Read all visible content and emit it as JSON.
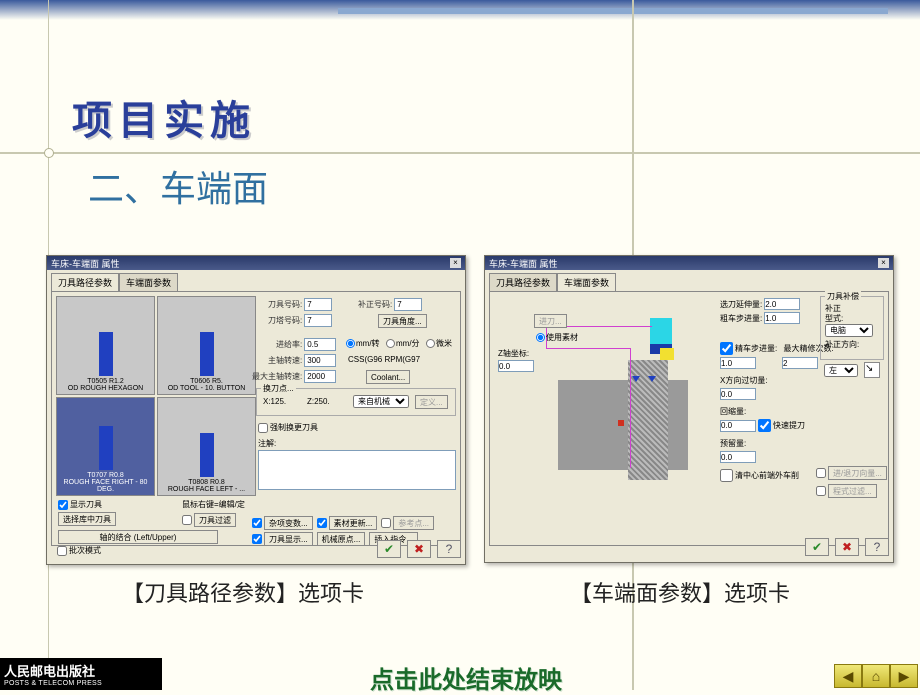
{
  "slide": {
    "title_main": "项目实施",
    "title_sub": "二、车端面",
    "caption_left": "【刀具路径参数】选项卡",
    "caption_right": "【车端面参数】选项卡",
    "footer_link": "点击此处结束放映"
  },
  "publisher": {
    "cn": "人民邮电出版社",
    "en": "POSTS & TELECOM PRESS"
  },
  "dialog_left": {
    "title": "车床-车端面 属性",
    "tabs": [
      "刀具路径参数",
      "车端面参数"
    ],
    "tools": [
      {
        "code": "T0505 R1.2",
        "desc": "OD ROUGH HEXAGON"
      },
      {
        "code": "T0606 R5.",
        "desc": "OD TOOL - 10. BUTTON"
      },
      {
        "code": "T0707 R0.8",
        "desc": "ROUGH FACE RIGHT - 80 DEG.",
        "selected": true
      },
      {
        "code": "T0808 R0.8",
        "desc": "ROUGH FACE LEFT - ..."
      }
    ],
    "show_tool_chk": "显示刀具",
    "select_lib_btn": "选择库中刀具",
    "mouse_hint": "鼠标右键=编辑/定",
    "tool_filter_btn": "刀具过滤",
    "axis_combine_btn": "轴的结合 (Left/Upper)",
    "batch_mode_chk": "批次模式",
    "fields": {
      "tool_num": {
        "label": "刀具号码:",
        "value": "7"
      },
      "offset_num": {
        "label": "补正号码:",
        "value": "7"
      },
      "station_num": {
        "label": "刀塔号码:",
        "value": "7"
      },
      "tool_angle_btn": "刀具角度...",
      "feed_rate": {
        "label": "进给率:",
        "value": "0.5"
      },
      "feed_unit_rev": "mm/转",
      "feed_unit_min": "mm/分",
      "feed_unit_micro": "微米",
      "spindle_speed": {
        "label": "主轴转速:",
        "value": "300"
      },
      "css": "CSS(G96   RPM(G97",
      "max_spindle": {
        "label": "最大主轴转速:",
        "value": "2000"
      },
      "coolant_btn": "Coolant...",
      "change_point": {
        "label": "换刀点...",
        "x": "X:125.",
        "z": "Z:250.",
        "mode": "来自机械"
      },
      "define_btn": "定义...",
      "force_change_chk": "强制换更刀具",
      "note_label": "注解:"
    },
    "bottom": {
      "misc_btn": "杂项变数...",
      "stock_update_btn": "素材更新...",
      "ref_point_btn": "参考点...",
      "tool_display_btn": "刀具显示...",
      "machine_origin_btn": "机械原点...",
      "insert_cmd_btn": "插入指令..."
    }
  },
  "dialog_right": {
    "title": "车床-车端面 属性",
    "tabs": [
      "刀具路径参数",
      "车端面参数"
    ],
    "feed_btn": "进刀...",
    "use_stock": "使用素材",
    "z_coord": {
      "label": "Z轴坐标:",
      "value": "0.0"
    },
    "adaptive_ext": {
      "label": "选刀延伸量:",
      "value": "2.0"
    },
    "rough_step": {
      "label": "粗车步进量:",
      "value": "1.0"
    },
    "finish_chk": "精车步进量:",
    "finish_val": "1.0",
    "max_finish": {
      "label": "最大精修次数:",
      "value": "2"
    },
    "x_reserve": {
      "label": "X方向过切量:",
      "value": "0.0"
    },
    "retract": {
      "label": "回缩量:",
      "value": "0.0"
    },
    "rapid_retract": "快速提刀",
    "reserve": {
      "label": "预留量:",
      "value": "0.0"
    },
    "feed_retract_btn": "进/退刀向量...",
    "program_filter_btn": "程式过滤...",
    "lead_hint": "清中心前端外车削",
    "comp_group": {
      "title": "刀具补偿",
      "comp_label": "补正",
      "comp_type_label": "型式:",
      "comp_type": "电脑",
      "dir_label": "补正方向:",
      "dir": "左"
    }
  },
  "icons": {
    "ok": "✔",
    "cancel": "✖",
    "help": "?",
    "close": "×",
    "prev": "◀",
    "home": "⌂",
    "next": "▶"
  }
}
